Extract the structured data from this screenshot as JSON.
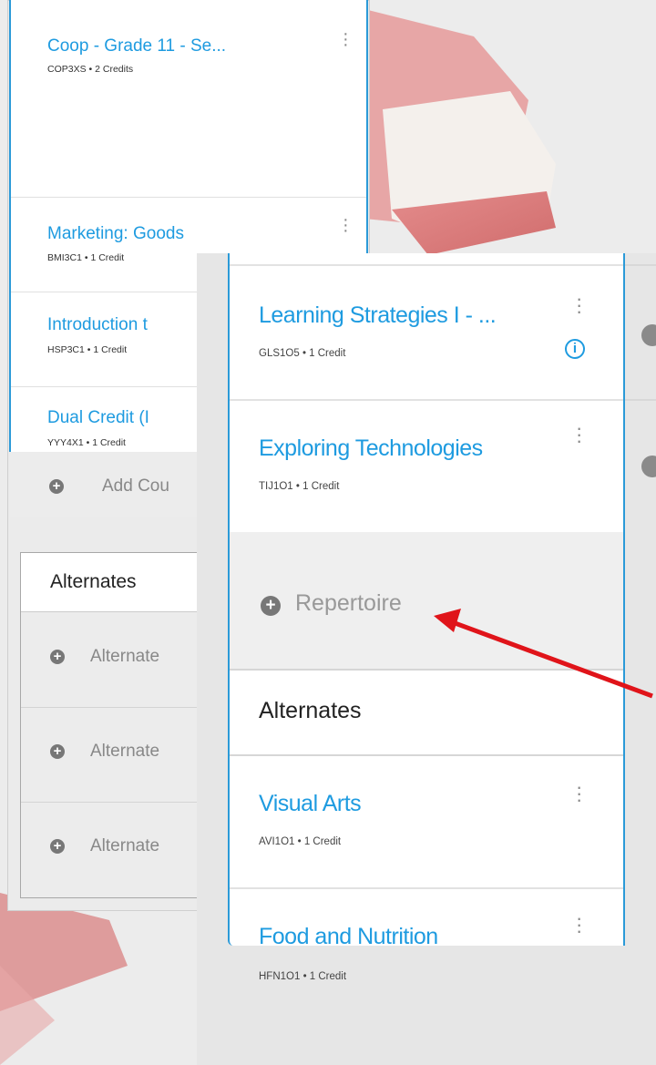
{
  "left_panel": {
    "courses": [
      {
        "title": "Coop - Grade 11 - Se...",
        "code": "COP3XS • 2 Credits"
      },
      {
        "title": "Marketing: Goods",
        "code": "BMI3C1 • 1 Credit"
      },
      {
        "title": "Introduction t",
        "code": "HSP3C1 • 1 Credit"
      },
      {
        "title": "Dual Credit (I",
        "code": "YYY4X1 • 1 Credit"
      }
    ],
    "add_course_label": "Add Cou",
    "alternates": {
      "title": "Alternates",
      "rows": [
        {
          "label": "Alternate"
        },
        {
          "label": "Alternate"
        },
        {
          "label": "Alternate"
        }
      ]
    }
  },
  "right_panel": {
    "courses": [
      {
        "title": "Learning Strategies I - ...",
        "code": "GLS1O5 • 1 Credit"
      },
      {
        "title": "Exploring Technologies",
        "code": "TIJ1O1 • 1 Credit"
      }
    ],
    "add_label": "Repertoire",
    "alternates": {
      "title": "Alternates",
      "courses": [
        {
          "title": "Visual Arts",
          "code": "AVI1O1 • 1 Credit"
        },
        {
          "title": "Food and Nutrition",
          "code": "HFN1O1 • 1 Credit"
        }
      ]
    }
  },
  "icons": {
    "more": "kebab-icon",
    "add": "plus-circle-icon",
    "info": "info-icon"
  },
  "colors": {
    "link": "#1e9be0",
    "column_border": "#2b9ad8",
    "annotation_arrow": "#e0141a"
  }
}
